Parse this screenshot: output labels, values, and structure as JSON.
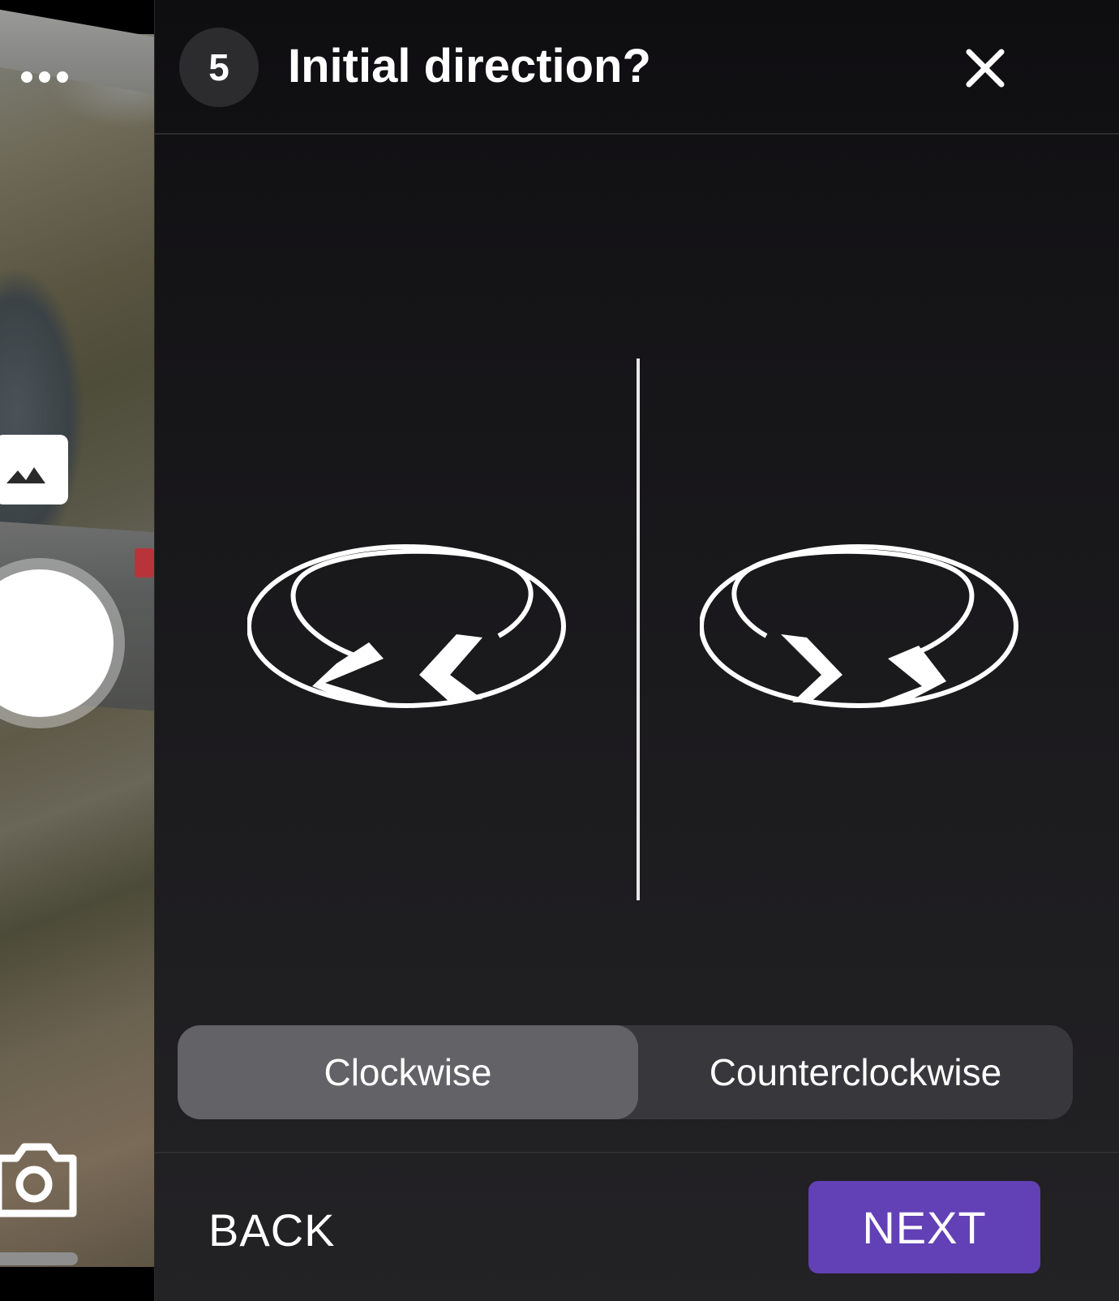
{
  "camera": {
    "more_icon": "more-horizontal-icon",
    "gallery_icon": "gallery-mountains-icon",
    "switch_icon": "camera-icon"
  },
  "dialog": {
    "step_number": "5",
    "title": "Initial direction?",
    "close_icon": "close-icon",
    "options": [
      {
        "label": "Clockwise",
        "selected": true,
        "icon": "orbit-clockwise-icon"
      },
      {
        "label": "Counterclockwise",
        "selected": false,
        "icon": "orbit-counterclockwise-icon"
      }
    ],
    "back_label": "BACK",
    "next_label": "NEXT"
  },
  "colors": {
    "accent": "#6240b5",
    "selected_segment": "#636266",
    "segment_track": "#38373b",
    "panel_background": "#1a191c"
  }
}
